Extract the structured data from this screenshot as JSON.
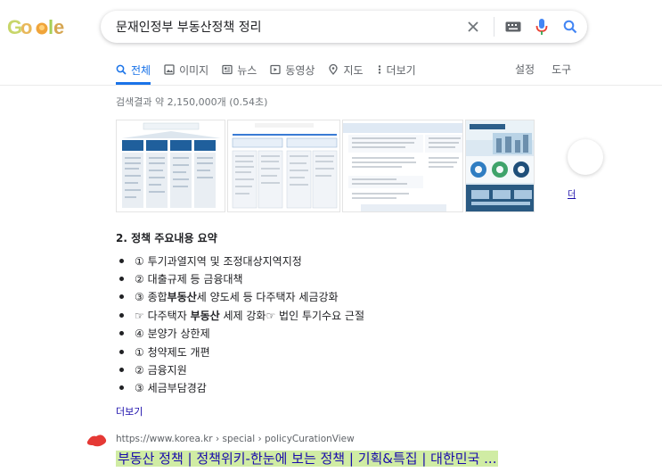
{
  "logo": {
    "text": "Google"
  },
  "search": {
    "query": "문재인정부 부동산정책 정리"
  },
  "tabs": [
    {
      "label": "전체",
      "icon": "search-icon",
      "active": true
    },
    {
      "label": "이미지",
      "icon": "image-icon"
    },
    {
      "label": "뉴스",
      "icon": "news-icon"
    },
    {
      "label": "동영상",
      "icon": "video-icon"
    },
    {
      "label": "지도",
      "icon": "map-pin-icon"
    },
    {
      "label": "더보기",
      "icon": "more-vert-icon"
    }
  ],
  "tools": {
    "settings": "설정",
    "tools": "도구"
  },
  "result_stats": "검색결과 약 2,150,000개 (0.54초)",
  "carousel": {
    "more_label": "더"
  },
  "featured": {
    "title": "2. 정책 주요내용 요약",
    "items": [
      {
        "before": "① 투기과열지역 및 조정대상지역지정",
        "bold": "",
        "after": ""
      },
      {
        "before": "② 대출규제 등 금융대책",
        "bold": "",
        "after": ""
      },
      {
        "before": "③ 종합",
        "bold": "부동산",
        "after": "세 양도세 등 다주택자 세금강화"
      },
      {
        "before": "☞ 다주택자 ",
        "bold": "부동산",
        "after": " 세제 강화☞ 법인 투기수요 근절"
      },
      {
        "before": "④ 분양가 상한제",
        "bold": "",
        "after": ""
      },
      {
        "before": "① 청약제도 개편",
        "bold": "",
        "after": ""
      },
      {
        "before": "② 금융지원",
        "bold": "",
        "after": ""
      },
      {
        "before": "③ 세금부담경감",
        "bold": "",
        "after": ""
      }
    ],
    "more_link": "더보기"
  },
  "result": {
    "cite": "https://www.korea.kr › special › policyCurationView",
    "title": "부동산 정책 | 정책위키-한눈에 보는 정책 | 기획&특집 | 대한민국 ..."
  },
  "colors": {
    "link": "#1a0dab",
    "accent": "#1a73e8",
    "highlight": "#aadc5a"
  }
}
